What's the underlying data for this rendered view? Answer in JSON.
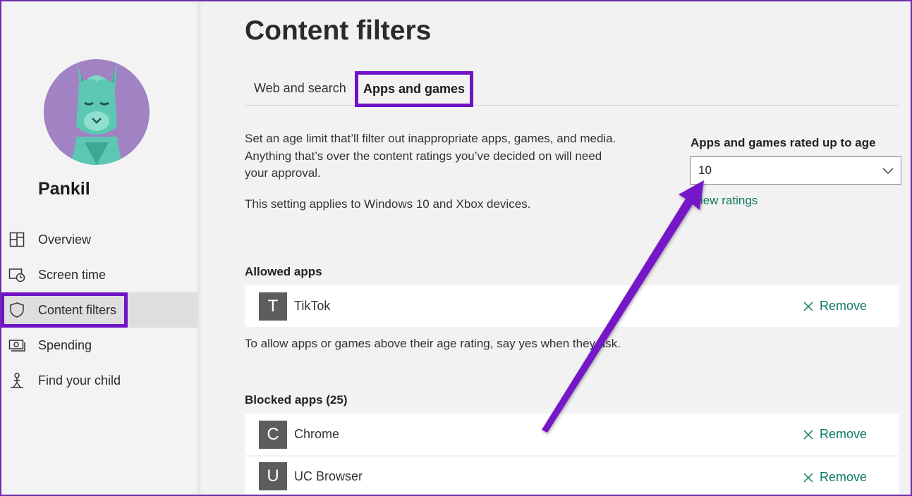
{
  "profile": {
    "name": "Pankil"
  },
  "nav": {
    "items": [
      {
        "label": "Overview",
        "icon": "overview-icon"
      },
      {
        "label": "Screen time",
        "icon": "screen-time-icon"
      },
      {
        "label": "Content filters",
        "icon": "shield-icon",
        "active": true
      },
      {
        "label": "Spending",
        "icon": "money-icon"
      },
      {
        "label": "Find your child",
        "icon": "person-location-icon"
      }
    ]
  },
  "main": {
    "title": "Content filters",
    "tabs": [
      {
        "label": "Web and search"
      },
      {
        "label": "Apps and games",
        "active": true
      }
    ],
    "description": "Set an age limit that’ll filter out inappropriate apps, games, and media. Anything that’s over the content ratings you’ve decided on will need your approval.",
    "devices_note": "This setting applies to Windows 10 and Xbox devices.",
    "age_limit": {
      "label": "Apps and games rated up to age",
      "value": "10",
      "link": "View ratings"
    },
    "allowed": {
      "title": "Allowed apps",
      "apps": [
        {
          "initial": "T",
          "name": "TikTok",
          "action": "Remove"
        }
      ],
      "note": "To allow apps or games above their age rating, say yes when they ask."
    },
    "blocked": {
      "title": "Blocked apps (25)",
      "apps": [
        {
          "initial": "C",
          "name": "Chrome",
          "action": "Remove"
        },
        {
          "initial": "U",
          "name": "UC Browser",
          "action": "Remove"
        }
      ]
    }
  },
  "colors": {
    "highlight": "#6f13c6",
    "link": "#0e7a62",
    "avatar_bg": "#a183c4",
    "llama": "#5cc7b2"
  }
}
